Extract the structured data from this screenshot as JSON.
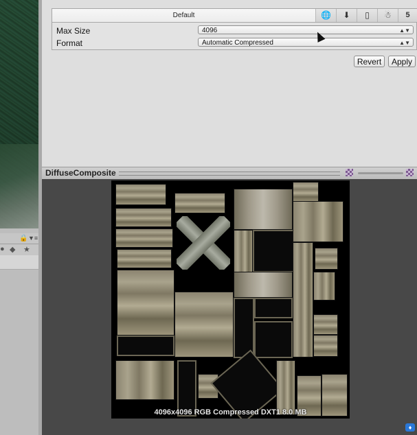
{
  "inspector": {
    "platform_tabs": {
      "default_label": "Default",
      "icons": [
        "globe-icon",
        "download-icon",
        "phone-icon",
        "android-icon",
        "html5-icon"
      ]
    },
    "max_size": {
      "label": "Max Size",
      "value": "4096"
    },
    "format": {
      "label": "Format",
      "value": "Automatic Compressed"
    },
    "buttons": {
      "revert": "Revert",
      "apply": "Apply"
    }
  },
  "preview": {
    "title": "DiffuseComposite",
    "caption": "4096x4096  RGB Compressed DXT1   8.0 MB"
  },
  "colors": {
    "accent": "#2a78d8",
    "panel": "#dedede",
    "preview_bg": "#484848"
  }
}
